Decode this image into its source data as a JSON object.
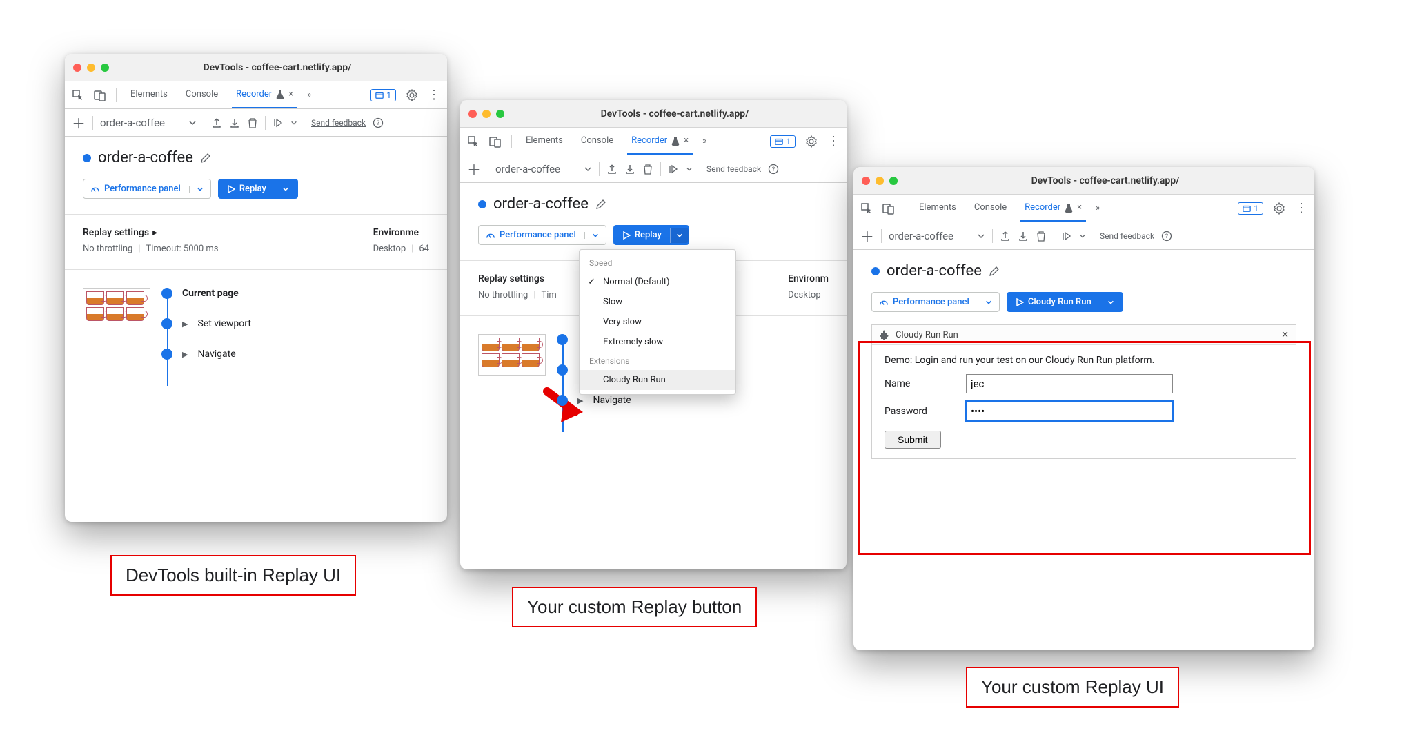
{
  "title": "DevTools - coffee-cart.netlify.app/",
  "tabs": {
    "elements": "Elements",
    "console": "Console",
    "recorder": "Recorder"
  },
  "issue_count": "1",
  "recording_name": "order-a-coffee",
  "send_feedback": "Send feedback",
  "perf_panel": "Performance panel",
  "replay": "Replay",
  "replay_custom": "Cloudy Run Run",
  "settings": {
    "replay_hd": "Replay settings",
    "throttle": "No throttling",
    "timeout": "Timeout: 5000 ms",
    "env_hd": "Environment",
    "device": "Desktop",
    "network": "64"
  },
  "steps": {
    "s1": "Current page",
    "s2": "Set viewport",
    "s3": "Navigate"
  },
  "dropdown": {
    "speed": "Speed",
    "normal": "Normal (Default)",
    "slow": "Slow",
    "vslow": "Very slow",
    "eslow": "Extremely slow",
    "ext": "Extensions",
    "cloudy": "Cloudy Run Run"
  },
  "ext_panel": {
    "title": "Cloudy Run Run",
    "demo": "Demo: Login and run your test on our Cloudy Run Run platform.",
    "name_label": "Name",
    "pass_label": "Password",
    "name_val": "jec",
    "pass_val": "••••",
    "submit": "Submit"
  },
  "captions": {
    "c1": "DevTools built-in Replay UI",
    "c2": "Your custom Replay button",
    "c3": "Your custom Replay UI"
  }
}
